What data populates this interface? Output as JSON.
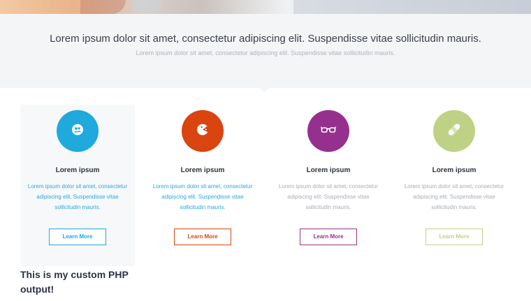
{
  "intro": {
    "title": "Lorem ipsum dolor sit amet, consectetur adipiscing elit. Suspendisse vitae sollicitudin mauris.",
    "subtitle": "Lorem ipsum dolor sit amet, consectetur adipiscing elit. Suspendisse vitae sollicitudin mauris."
  },
  "features": [
    {
      "title": "Lorem ipsum",
      "text": "Lorem ipsum dolor sit amet, consectetur adipiscing elit. Suspendisse vitae sollicitudin mauris.",
      "button": "Learn More",
      "color": "#1fa9dc",
      "icon": "users-icon"
    },
    {
      "title": "Lorem ipsum",
      "text": "Lorem ipsum dolor sit amet, consectetur adipiscing elit. Suspendisse vitae sollicitudin mauris.",
      "button": "Learn More",
      "color": "#d9440f",
      "icon": "pacman-icon"
    },
    {
      "title": "Lorem ipsum",
      "text": "Lorem ipsum dolor sit amet, consectetur adipiscing elit. Suspendisse vitae sollicitudin mauris.",
      "button": "Learn More",
      "color": "#96308f",
      "icon": "glasses-icon"
    },
    {
      "title": "Lorem ipsum",
      "text": "Lorem ipsum dolor sit amet, consectetur adipiscing elit. Suspendisse vitae sollicitudin mauris.",
      "button": "Learn More",
      "color": "#bfd185",
      "icon": "bandage-icon"
    }
  ],
  "custom_output": "This is my custom PHP output!"
}
